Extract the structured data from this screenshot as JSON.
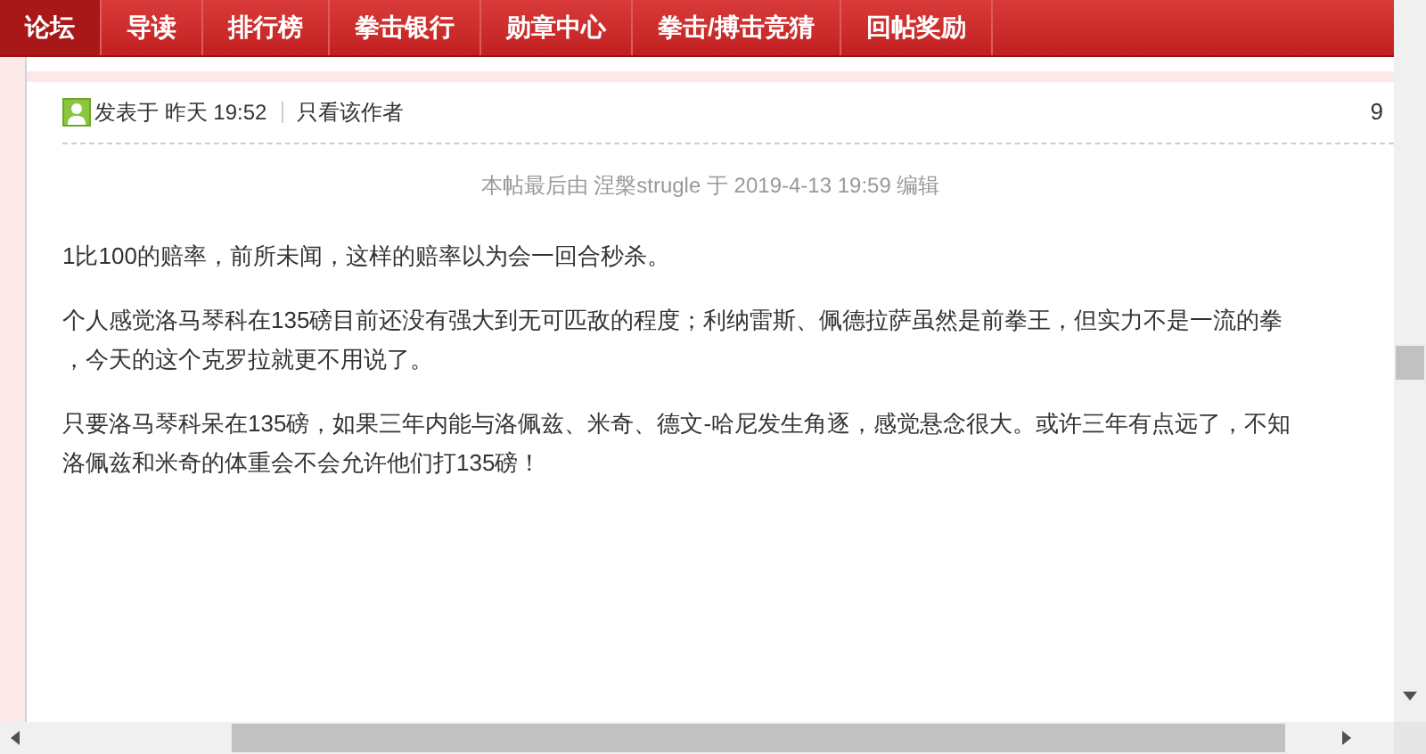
{
  "nav": [
    {
      "label": "论坛",
      "selected": true
    },
    {
      "label": "导读",
      "selected": false
    },
    {
      "label": "排行榜",
      "selected": false
    },
    {
      "label": "拳击银行",
      "selected": false
    },
    {
      "label": "勋章中心",
      "selected": false
    },
    {
      "label": "拳击/搏击竞猜",
      "selected": false
    },
    {
      "label": "回帖奖励",
      "selected": false
    }
  ],
  "post": {
    "posted": "发表于 昨天 19:52",
    "author_only": "只看该作者",
    "floor": "9",
    "edit_note": "本帖最后由 涅槃strugle 于 2019-4-13 19:59 编辑",
    "paragraphs": [
      [
        "1比100的赔率，前所未闻，这样的赔率以为会一回合秒杀。"
      ],
      [
        "个人感觉洛马琴科在135磅目前还没有强大到无可匹敌的程度；利纳雷斯、佩德拉萨虽然是前拳王，但实力不是一流的拳",
        "，今天的这个克罗拉就更不用说了。"
      ],
      [
        "只要洛马琴科呆在135磅，如果三年内能与洛佩兹、米奇、德文-哈尼发生角逐，感觉悬念很大。或许三年有点远了，不知",
        "洛佩兹和米奇的体重会不会允许他们打135磅！"
      ]
    ]
  }
}
